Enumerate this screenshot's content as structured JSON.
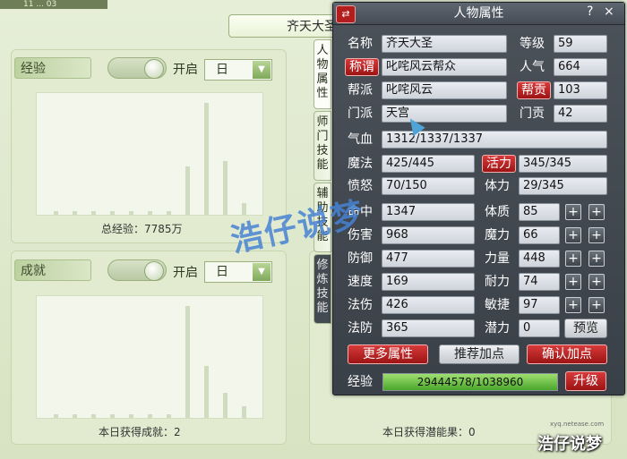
{
  "topbar": {
    "text": "11 ... 03"
  },
  "background_panel": {
    "title": "齐天大圣",
    "experience_section": {
      "label": "经验",
      "toggle_label": "开启",
      "period_select": "日",
      "bars": [
        0.03,
        0.03,
        0.03,
        0.03,
        0.03,
        0.03,
        0.03,
        0.42,
        0.98,
        0.47,
        0.1
      ],
      "total_text": "总经验：7785万"
    },
    "achievement_section": {
      "label": "成就",
      "toggle_label": "开启",
      "period_select": "日",
      "bars": [
        0.03,
        0.03,
        0.03,
        0.03,
        0.03,
        0.03,
        0.03,
        0.98,
        0.45,
        0.22,
        0.1
      ],
      "total_text": "本日获得成就：2"
    },
    "potential_text": "本日获得潜能果：0"
  },
  "side_tabs": [
    {
      "label": "人物属性"
    },
    {
      "label": "师门技能"
    },
    {
      "label": "辅助技能"
    },
    {
      "label": "修炼技能"
    }
  ],
  "window": {
    "title": "人物属性",
    "help": "?",
    "close": "×",
    "swap": "⇄",
    "rows": {
      "name_label": "名称",
      "name_value": "齐天大圣",
      "level_label": "等级",
      "level_value": "59",
      "title_btn": "称谓",
      "title_value": "叱咤风云帮众",
      "popularity_label": "人气",
      "popularity_value": "664",
      "gang_label": "帮派",
      "gang_value": "叱咤风云",
      "gang_contrib_btn": "帮贡",
      "gang_contrib_value": "103",
      "sect_label": "门派",
      "sect_value": "天宫",
      "sect_contrib_label": "门贡",
      "sect_contrib_value": "42",
      "hp_label": "气血",
      "hp_value": "1312/1337/1337",
      "mp_label": "魔法",
      "mp_value": "425/445",
      "vitality_btn": "活力",
      "vitality_value": "345/345",
      "anger_label": "愤怒",
      "anger_value": "70/150",
      "stamina_label": "体力",
      "stamina_value": "29/345"
    },
    "stats_left": [
      {
        "label": "命中",
        "value": "1347"
      },
      {
        "label": "伤害",
        "value": "968"
      },
      {
        "label": "防御",
        "value": "477"
      },
      {
        "label": "速度",
        "value": "169"
      },
      {
        "label": "法伤",
        "value": "426"
      },
      {
        "label": "法防",
        "value": "365"
      }
    ],
    "stats_right": [
      {
        "label": "体质",
        "value": "85"
      },
      {
        "label": "魔力",
        "value": "66"
      },
      {
        "label": "力量",
        "value": "448"
      },
      {
        "label": "耐力",
        "value": "74"
      },
      {
        "label": "敏捷",
        "value": "97"
      },
      {
        "label": "潜力",
        "value": "0"
      }
    ],
    "plus_symbol": "+",
    "preview_btn": "预览",
    "more_btn": "更多属性",
    "recommend_btn": "推荐加点",
    "confirm_btn": "确认加点",
    "exp_label": "经验",
    "exp_value": "29444578/1038960",
    "exp_fill": 1.0,
    "upgrade_btn": "升级"
  },
  "watermark": "浩仔说梦",
  "brand": {
    "name": "浩仔说梦",
    "sub": "xyq.netease.com"
  }
}
